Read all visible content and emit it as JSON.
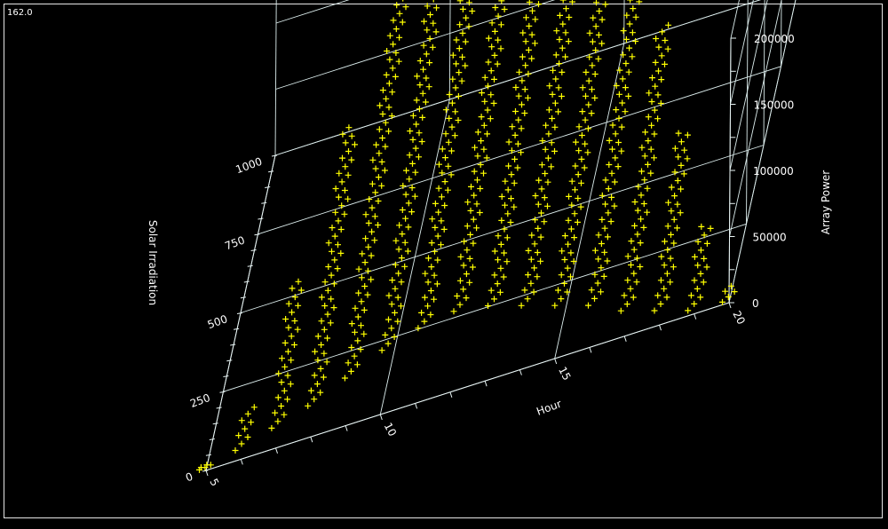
{
  "window": {
    "rotation_readout": "162.0"
  },
  "chart_data": {
    "type": "scatter",
    "title": "",
    "xlabel": "Hour",
    "ylabel": "Solar Irradiation",
    "zlabel": "Array Power",
    "xlim": [
      5,
      20
    ],
    "ylim": [
      0,
      1000
    ],
    "zlim": [
      0,
      200000
    ],
    "x_ticks": [
      5,
      10,
      15,
      20
    ],
    "x_tick_labels": [
      "5",
      "10",
      "15",
      "20"
    ],
    "y_ticks": [
      0,
      250,
      500,
      750,
      1000
    ],
    "y_tick_labels": [
      "0",
      "250",
      "500",
      "750",
      "1000"
    ],
    "z_ticks": [
      0,
      50000,
      100000,
      150000,
      200000
    ],
    "z_tick_labels": [
      "0",
      "50000",
      "100000",
      "150000",
      "200000"
    ],
    "marker": "+",
    "marker_color": "#ffff00",
    "axis_color": "#e8f4f4",
    "background_color": "#000000",
    "grid": true,
    "series": [
      {
        "points": [
          {
            "hour": 5,
            "irr_min": 5,
            "irr_max": 10
          },
          {
            "hour": 6,
            "irr_min": 20,
            "irr_max": 90
          },
          {
            "hour": 7,
            "irr_min": 40,
            "irr_max": 300
          },
          {
            "hour": 8,
            "irr_min": 60,
            "irr_max": 560
          },
          {
            "hour": 9,
            "irr_min": 90,
            "irr_max": 780
          },
          {
            "hour": 10,
            "irr_min": 120,
            "irr_max": 940
          },
          {
            "hour": 11,
            "irr_min": 140,
            "irr_max": 1010
          },
          {
            "hour": 12,
            "irr_min": 150,
            "irr_max": 1030
          },
          {
            "hour": 13,
            "irr_min": 140,
            "irr_max": 1010
          },
          {
            "hour": 14,
            "irr_min": 120,
            "irr_max": 960
          },
          {
            "hour": 15,
            "irr_min": 100,
            "irr_max": 870
          },
          {
            "hour": 16,
            "irr_min": 80,
            "irr_max": 730
          },
          {
            "hour": 17,
            "irr_min": 50,
            "irr_max": 560
          },
          {
            "hour": 18,
            "irr_min": 30,
            "irr_max": 350
          },
          {
            "hour": 19,
            "irr_min": 10,
            "irr_max": 160
          },
          {
            "hour": 20,
            "irr_min": 5,
            "irr_max": 30
          }
        ]
      }
    ]
  }
}
